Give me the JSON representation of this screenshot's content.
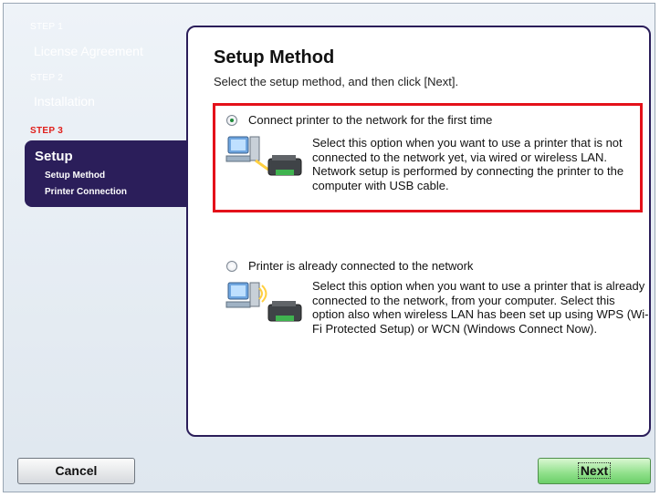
{
  "sidebar": {
    "steps": [
      {
        "label": "STEP 1",
        "title": "License Agreement"
      },
      {
        "label": "STEP 2",
        "title": "Installation"
      },
      {
        "label": "STEP 3",
        "title": "Setup"
      }
    ],
    "sub_items": [
      "Setup Method",
      "Printer Connection"
    ]
  },
  "main": {
    "title": "Setup Method",
    "subtitle": "Select the setup method, and then click [Next].",
    "options": [
      {
        "label": "Connect printer to the network for the first time",
        "description": "Select this option when you want to use a printer that is not connected to the network yet, via wired or wireless LAN. Network setup is performed by connecting the printer to the computer with USB cable.",
        "selected": true
      },
      {
        "label": "Printer is already connected to the network",
        "description": "Select this option when you want to use a printer that is already connected to the network, from your computer. Select this option also when wireless LAN has been set up using WPS (Wi-Fi Protected Setup) or WCN (Windows Connect Now).",
        "selected": false
      }
    ]
  },
  "buttons": {
    "cancel": "Cancel",
    "next": "Next"
  },
  "colors": {
    "accent": "#2b1e5a",
    "highlight": "#e4111a",
    "next_button": "#8fe08a",
    "active_step": "#e0201c"
  }
}
